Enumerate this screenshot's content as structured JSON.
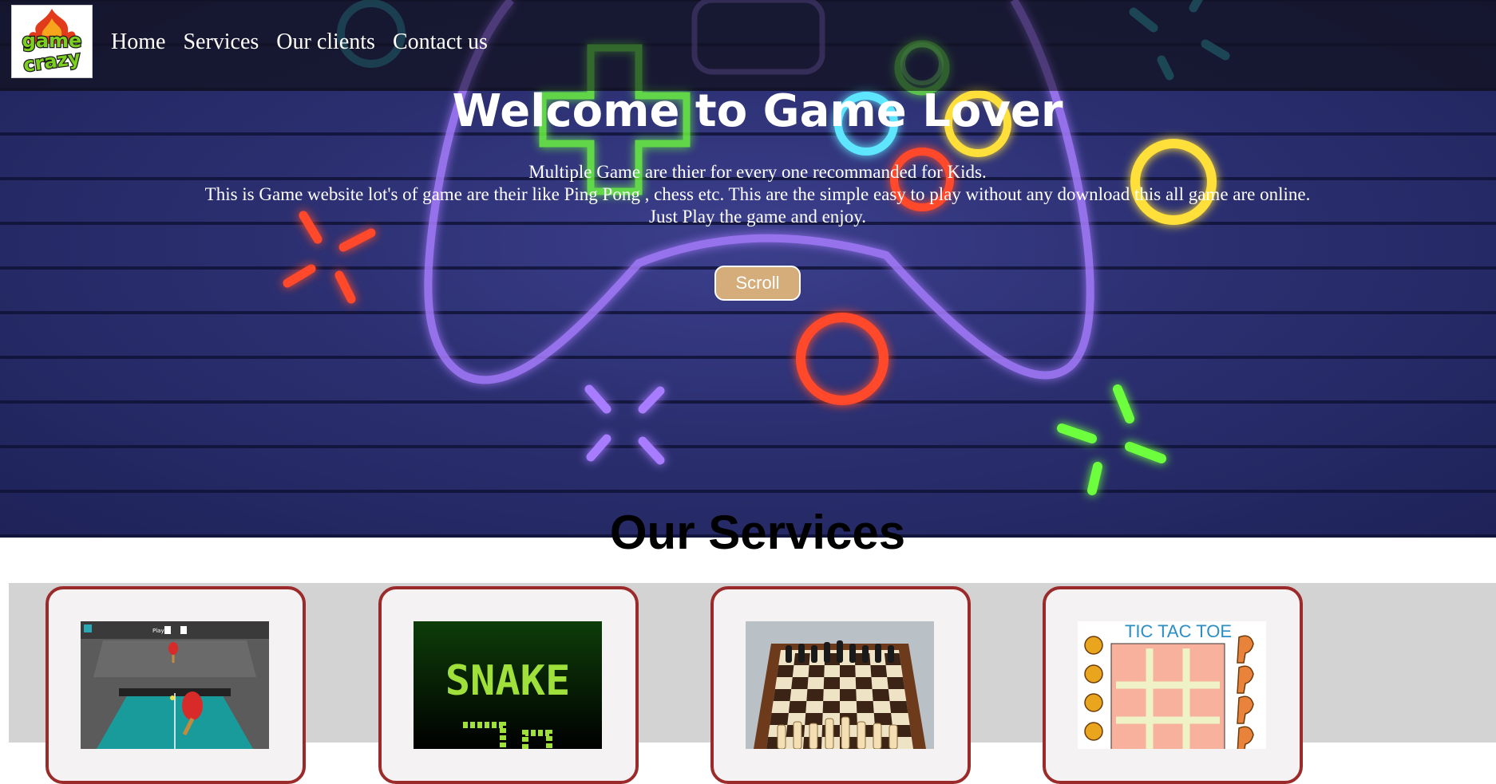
{
  "logo": {
    "alt_text": "game crazy",
    "line1": "game",
    "line2": "crazy"
  },
  "nav": {
    "items": [
      {
        "label": "Home"
      },
      {
        "label": "Services"
      },
      {
        "label": "Our clients"
      },
      {
        "label": "Contact us"
      }
    ]
  },
  "hero": {
    "title": "Welcome to Game Lover",
    "lines": [
      "Multiple Game are thier for every one recommanded for Kids.",
      "This is Game website lot's of game are their like Ping Pong , chess etc. This are the simple easy to play without any download this all game are online.",
      "Just Play the game and enjoy."
    ],
    "scroll_label": "Scroll"
  },
  "services": {
    "title": "Our Services",
    "cards": [
      {
        "name": "ping-pong",
        "thumb_text": "Player"
      },
      {
        "name": "snake",
        "thumb_text": "SNAKE"
      },
      {
        "name": "chess",
        "thumb_text": ""
      },
      {
        "name": "tic-tac-toe",
        "thumb_text": "TIC TAC TOE"
      }
    ]
  },
  "colors": {
    "hero_bg": "#252a63",
    "scroll_button": "#d5ad7b",
    "card_border": "#9b2b2b",
    "strip_bg": "#d3d3d3",
    "neon_purple": "#a77bff",
    "neon_green": "#6dff3d",
    "neon_yellow": "#ffe03a",
    "neon_red": "#ff4a2a",
    "neon_cyan": "#5fe6ff"
  }
}
